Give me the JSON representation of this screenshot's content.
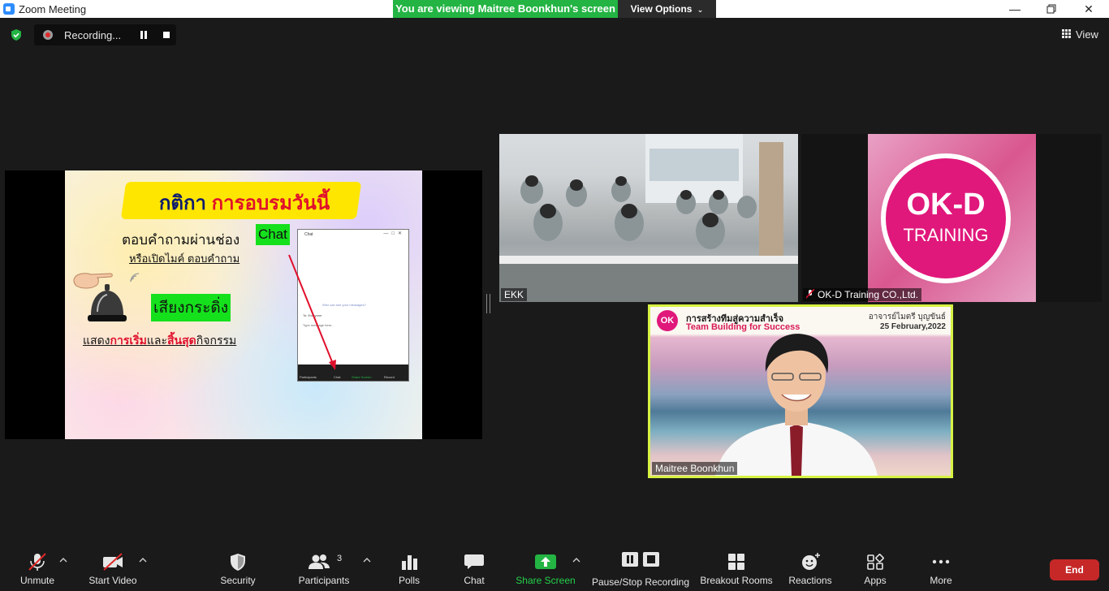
{
  "window": {
    "title": "Zoom Meeting"
  },
  "share": {
    "banner": "You are viewing Maitree Boonkhun's screen",
    "view_options": "View Options"
  },
  "topbar": {
    "recording_label": "Recording...",
    "view_label": "View"
  },
  "slide": {
    "title_part1": "กติกา",
    "title_part2": "การอบรมวันนี้",
    "line1": "ตอบคำถามผ่านช่อง",
    "chat_word": "Chat",
    "line2": "หรือเปิดไมค์ ตอบคำถาม",
    "bell_label": "เสียงกระดิ่ง",
    "line3_a": "แสดง",
    "line3_b": "การเริ่ม",
    "line3_c": "และ",
    "line3_d": "สิ้นสุด",
    "line3_e": "กิจกรรม",
    "mini_chat": {
      "title": "Chat",
      "privacy": "Who can see your messages?",
      "to": "To: Everyone",
      "placeholder": "Type message here...",
      "toolbar": [
        "Participants",
        "Chat",
        "Share Screen",
        "Record"
      ]
    }
  },
  "participants": {
    "tile1_name": "EKK",
    "tile2_name": "OK-D Training CO.,Ltd.",
    "tile2_logo_line1": "OK-D",
    "tile2_logo_line2": "TRAINING",
    "speaker_name": "Maitree Boonkhun"
  },
  "virtual_background": {
    "logo": "OK",
    "thai_title": "การสร้างทีมสู่ความสำเร็จ",
    "english_title": "Team Building for Success",
    "instructor": "อาจารย์ไมตรี บุญขันธ์",
    "date": "25 February,2022"
  },
  "toolbar": {
    "unmute": "Unmute",
    "start_video": "Start Video",
    "security": "Security",
    "participants": "Participants",
    "participants_count": "3",
    "polls": "Polls",
    "chat": "Chat",
    "share_screen": "Share Screen",
    "pause_stop_recording": "Pause/Stop Recording",
    "breakout_rooms": "Breakout Rooms",
    "reactions": "Reactions",
    "apps": "Apps",
    "more": "More",
    "end": "End"
  },
  "colors": {
    "share_green": "#23b443",
    "active_speaker_border": "#d7f243",
    "end_red": "#c62828",
    "brand_pink": "#e0187b"
  }
}
